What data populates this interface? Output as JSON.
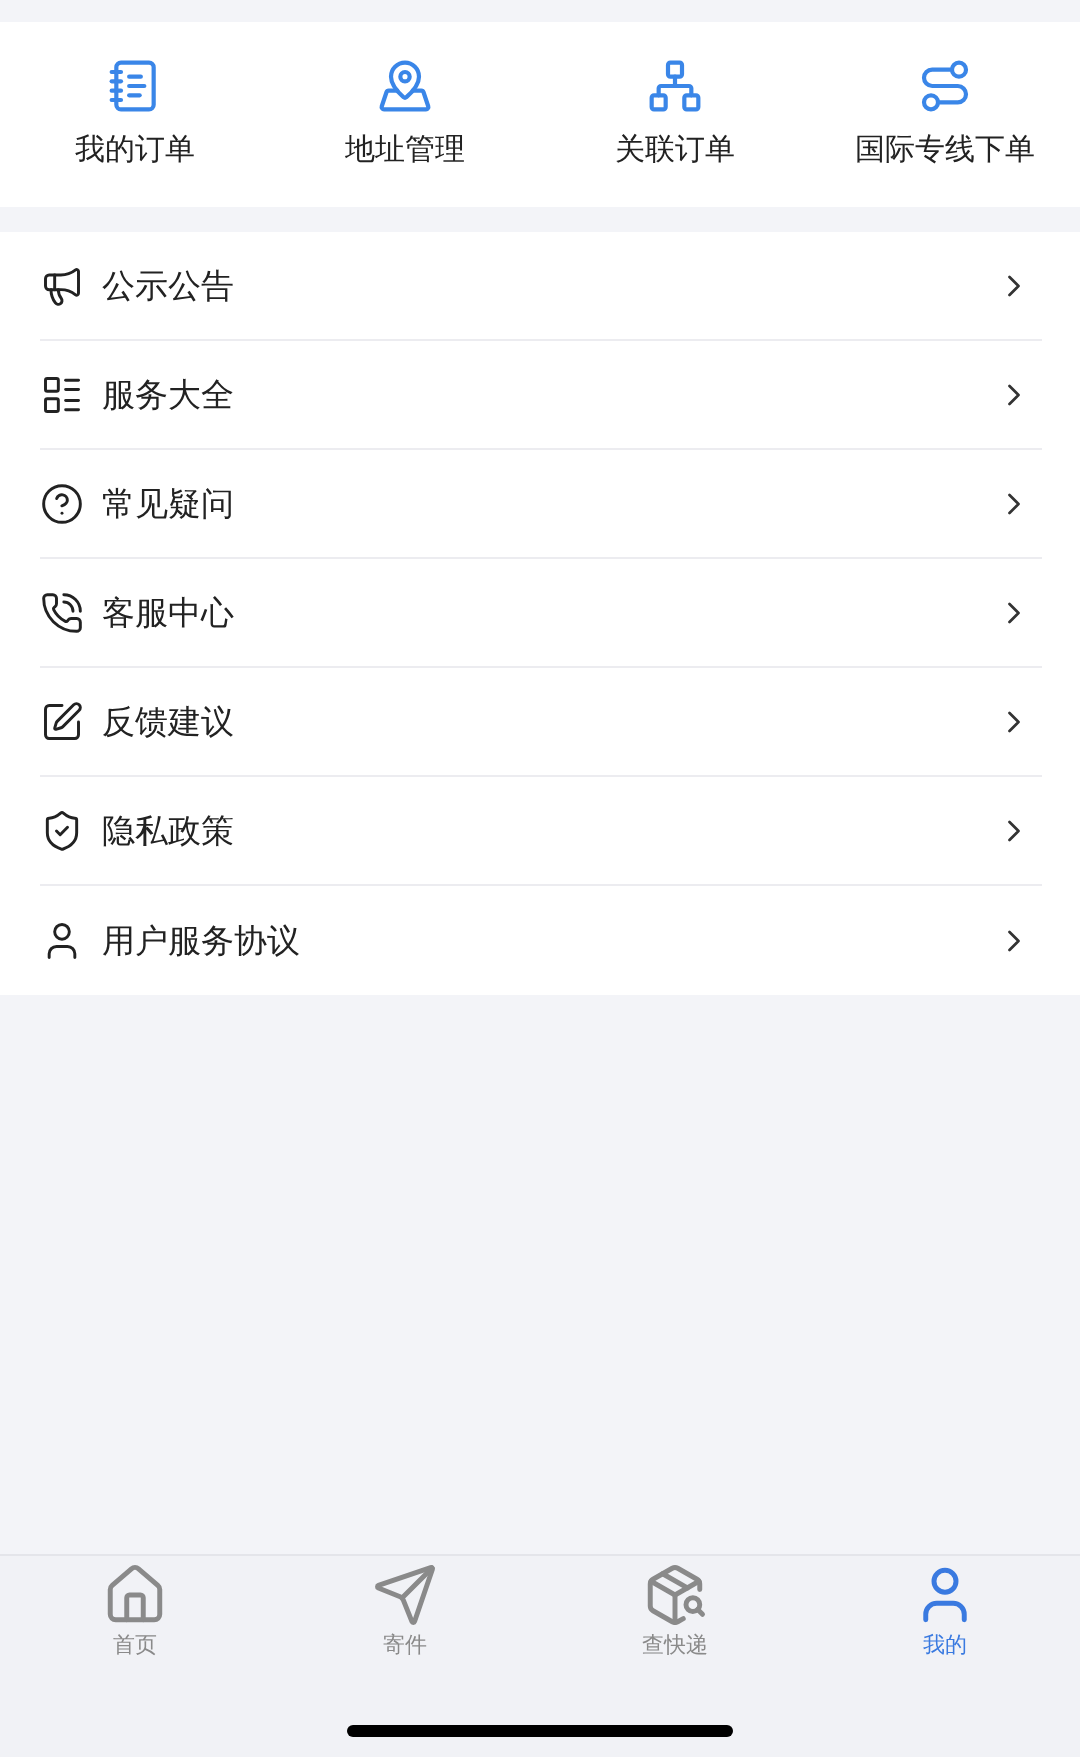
{
  "quick_actions": [
    {
      "label": "我的订单"
    },
    {
      "label": "地址管理"
    },
    {
      "label": "关联订单"
    },
    {
      "label": "国际专线下单"
    }
  ],
  "menu": [
    {
      "label": "公示公告"
    },
    {
      "label": "服务大全"
    },
    {
      "label": "常见疑问"
    },
    {
      "label": "客服中心"
    },
    {
      "label": "反馈建议"
    },
    {
      "label": "隐私政策"
    },
    {
      "label": "用户服务协议"
    }
  ],
  "tab_bar": [
    {
      "label": "首页",
      "selected": false
    },
    {
      "label": "寄件",
      "selected": false
    },
    {
      "label": "查快递",
      "selected": false
    },
    {
      "label": "我的",
      "selected": true
    }
  ]
}
